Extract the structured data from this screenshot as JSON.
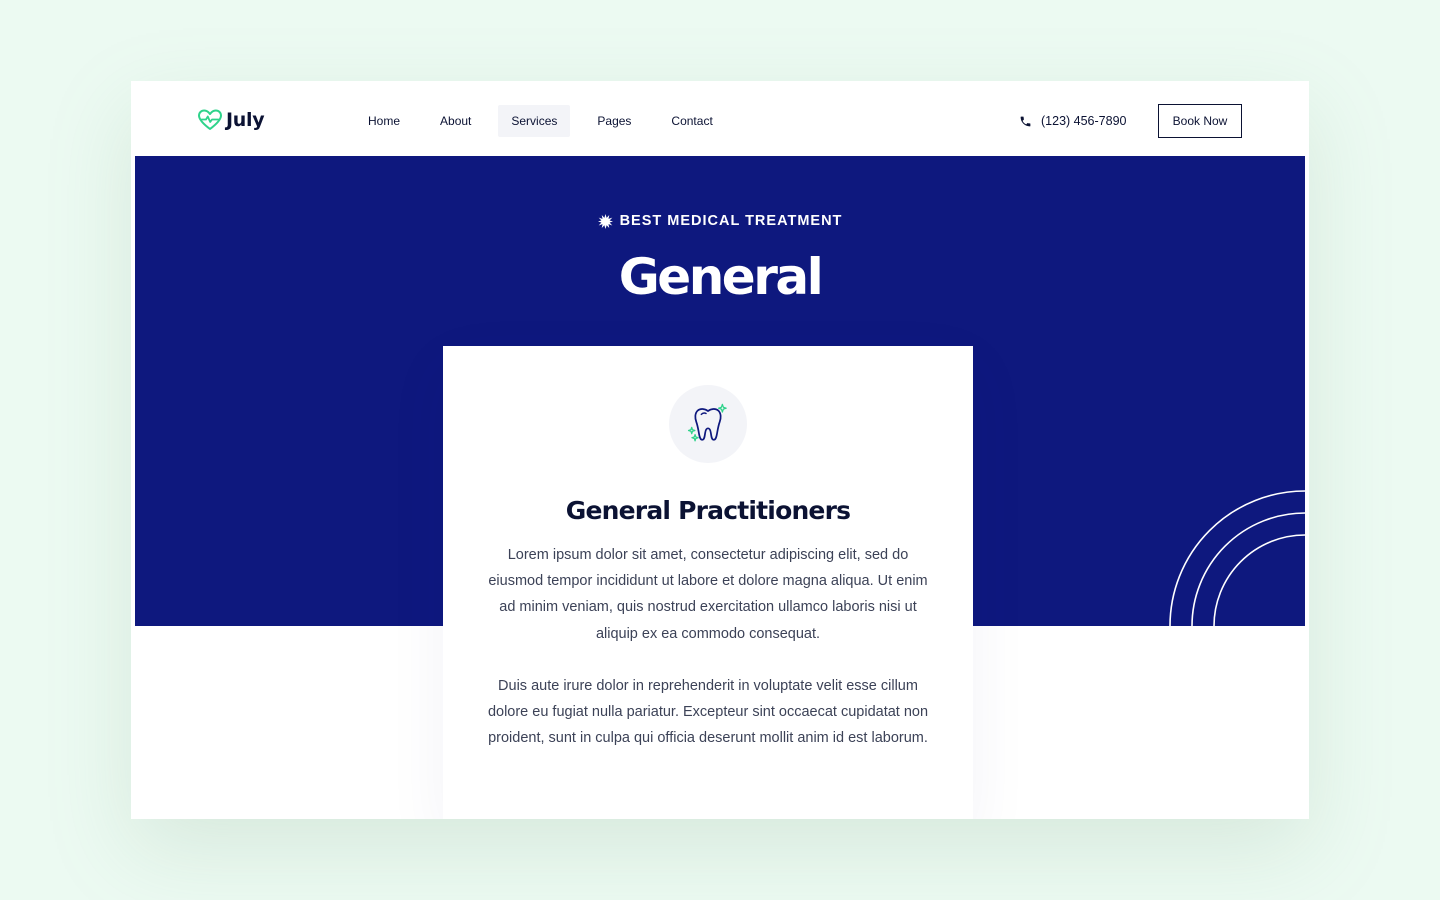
{
  "brand": {
    "name": "July",
    "accent": "#2fd38b"
  },
  "nav": {
    "items": [
      {
        "label": "Home"
      },
      {
        "label": "About"
      },
      {
        "label": "Services",
        "active": true
      },
      {
        "label": "Pages"
      },
      {
        "label": "Contact"
      }
    ]
  },
  "header": {
    "phone": "(123) 456-7890",
    "phone_icon": "phone-icon",
    "cta_label": "Book Now"
  },
  "hero": {
    "eyebrow": "BEST MEDICAL TREATMENT",
    "eyebrow_icon": "starburst-icon",
    "title": "General",
    "background": "#0e187e"
  },
  "card": {
    "icon": "tooth-icon",
    "title": "General Practitioners",
    "paragraphs": [
      "Lorem ipsum dolor sit amet, consectetur adipiscing elit, sed do eiusmod tempor incididunt ut labore et dolore magna aliqua. Ut enim ad minim veniam, quis nostrud exercitation ullamco laboris nisi ut aliquip ex ea commodo consequat.",
      "Duis aute irure dolor in reprehenderit in voluptate velit esse cillum dolore eu fugiat nulla pariatur. Excepteur sint occaecat cupidatat non proident, sunt in culpa qui officia deserunt mollit anim id est laborum."
    ]
  }
}
